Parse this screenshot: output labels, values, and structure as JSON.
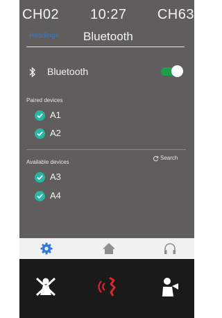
{
  "status_bar": {
    "channel_left": "CH02",
    "time": "10:27",
    "channel_right": "CH63"
  },
  "header": {
    "parent_label": "Headings",
    "title": "Bluetooth"
  },
  "bluetooth": {
    "label": "Bluetooth",
    "enabled": true
  },
  "paired": {
    "label": "Paired devices",
    "devices": [
      "A1",
      "A2"
    ]
  },
  "available": {
    "label": "Available devices",
    "search_label": "Search",
    "devices": [
      "A3",
      "A4"
    ]
  },
  "tabbar": {
    "active": "settings",
    "items": [
      "settings-icon",
      "home-icon",
      "headphones-icon"
    ]
  },
  "bottom_bar": {
    "items": [
      "mute-person-icon",
      "call-sound-icon",
      "speaker-person-icon"
    ]
  },
  "colors": {
    "accent": "#1f9d4a",
    "check": "#27b5a8",
    "active_tab": "#2f7bd6",
    "call": "#e0262a"
  }
}
